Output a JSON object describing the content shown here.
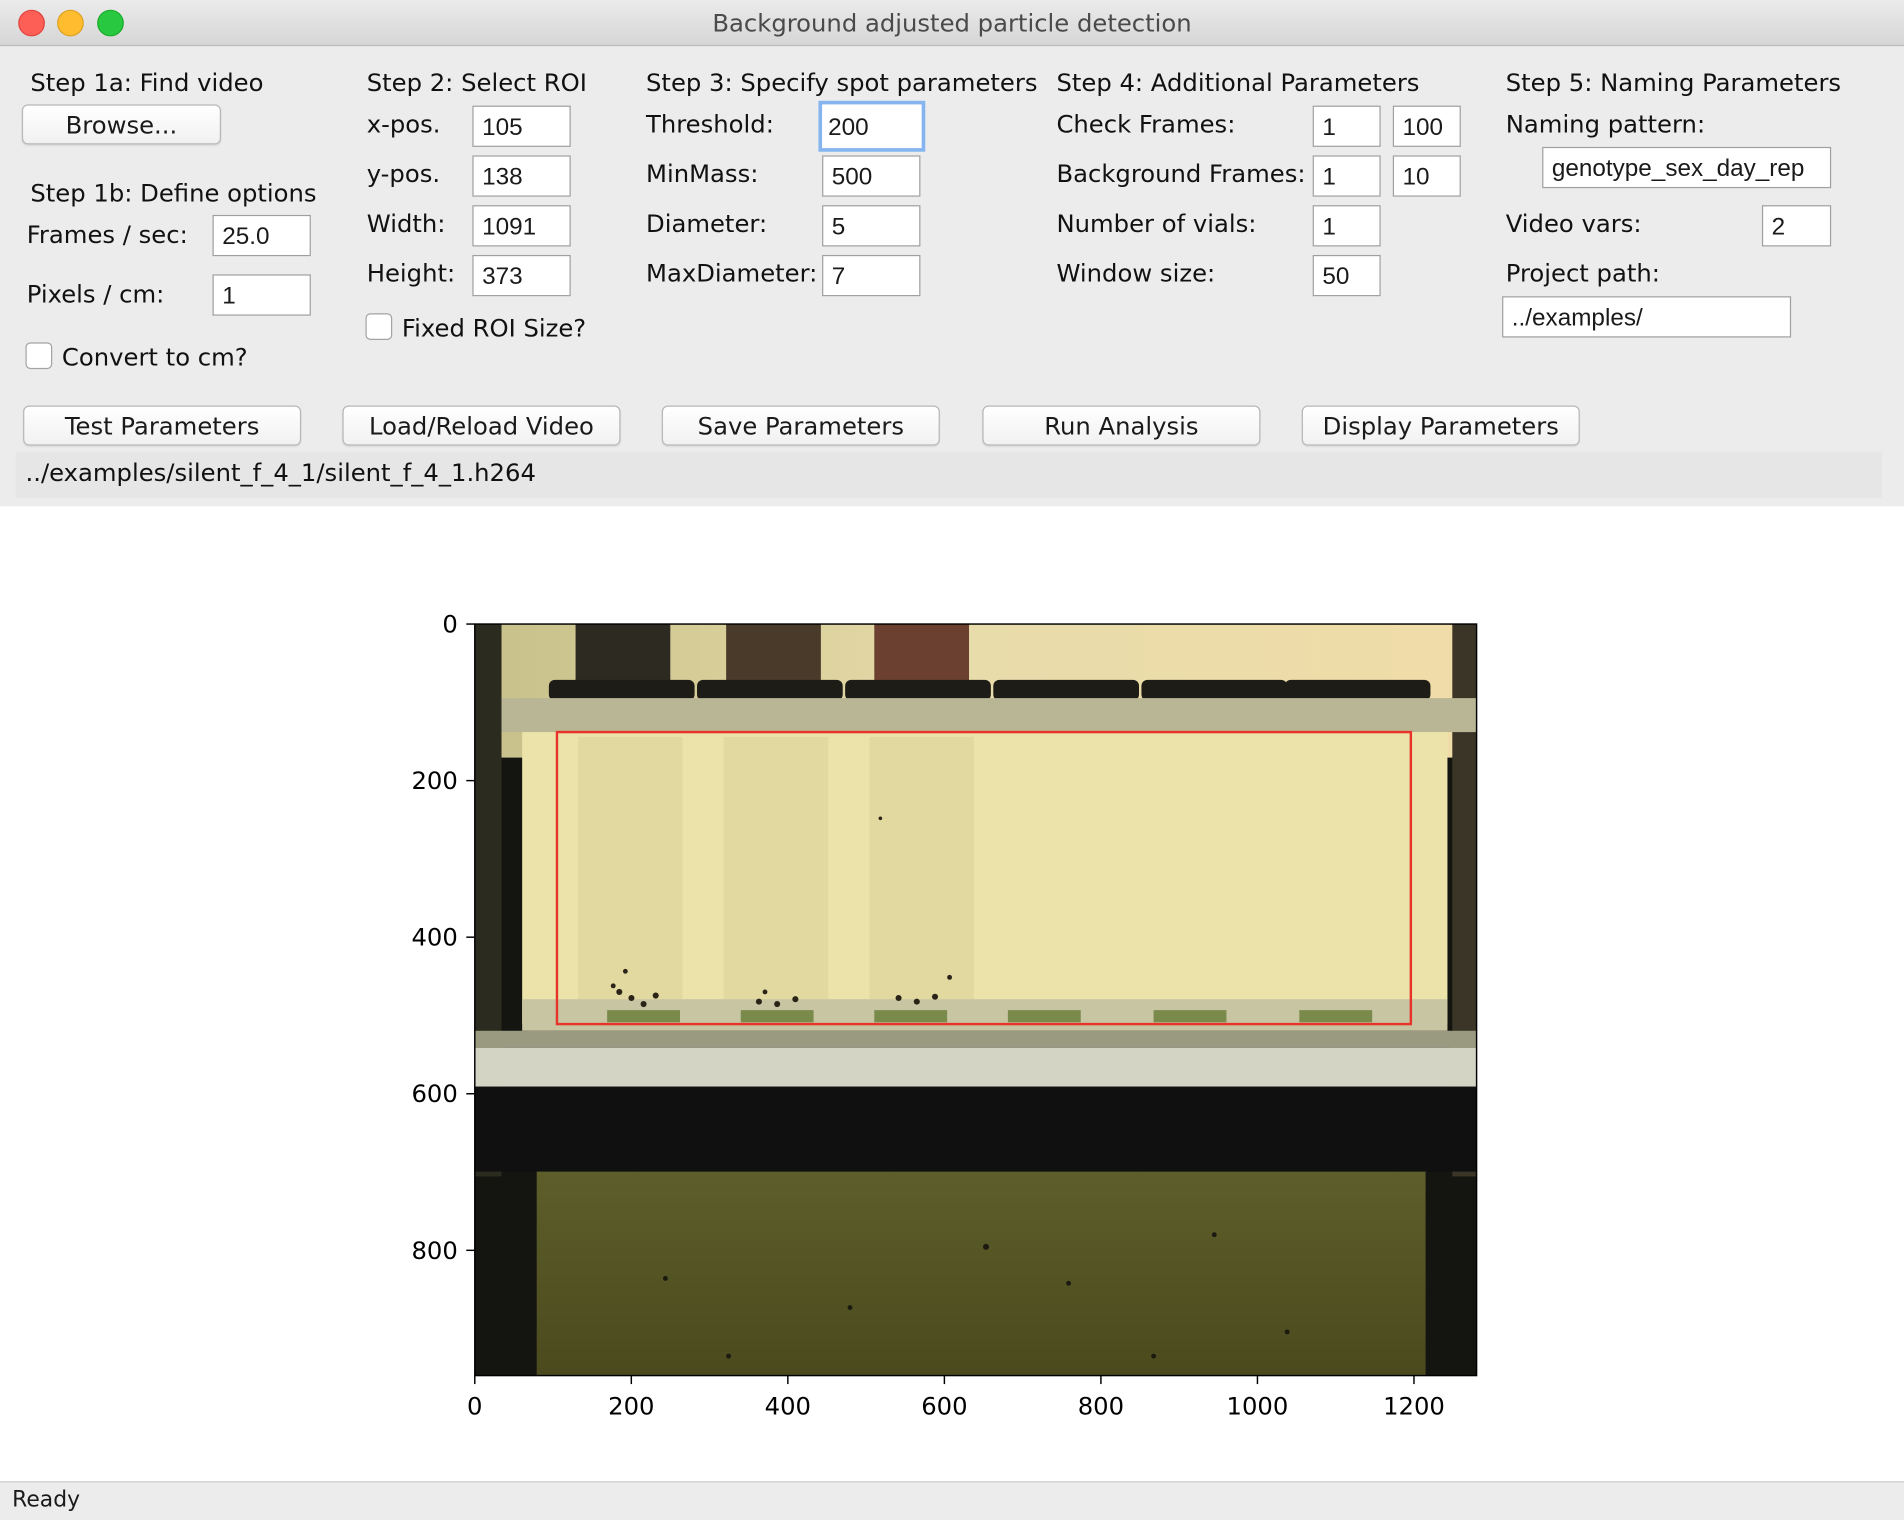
{
  "window": {
    "title": "Background adjusted particle detection"
  },
  "step1": {
    "heading_a": "Step 1a: Find video",
    "browse_label": "Browse...",
    "heading_b": "Step 1b: Define options",
    "fps_label": "Frames / sec:",
    "fps_value": "25.0",
    "pixels_label": "Pixels / cm:",
    "pixels_value": "1",
    "convert_label": "Convert to cm?",
    "convert_checked": false
  },
  "step2": {
    "heading": "Step 2: Select ROI",
    "x_label": "x-pos.",
    "x_value": "105",
    "y_label": "y-pos.",
    "y_value": "138",
    "width_label": "Width:",
    "width_value": "1091",
    "height_label": "Height:",
    "height_value": "373",
    "fixed_label": "Fixed ROI Size?",
    "fixed_checked": false
  },
  "step3": {
    "heading": "Step 3: Specify spot parameters",
    "threshold_label": "Threshold:",
    "threshold_value": "200",
    "minmass_label": "MinMass:",
    "minmass_value": "500",
    "diameter_label": "Diameter:",
    "diameter_value": "5",
    "maxdiameter_label": "MaxDiameter:",
    "maxdiameter_value": "7"
  },
  "step4": {
    "heading": "Step 4: Additional Parameters",
    "check_label": "Check Frames:",
    "check_from": "1",
    "check_to": "100",
    "bg_label": "Background Frames:",
    "bg_from": "1",
    "bg_to": "10",
    "vials_label": "Number of vials:",
    "vials_value": "1",
    "window_label": "Window size:",
    "window_value": "50"
  },
  "step5": {
    "heading": "Step 5: Naming Parameters",
    "pattern_label": "Naming pattern:",
    "pattern_value": "genotype_sex_day_rep",
    "vars_label": "Video vars:",
    "vars_value": "2",
    "path_label": "Project path:",
    "path_value": "../examples/"
  },
  "actions": {
    "test": "Test Parameters",
    "load": "Load/Reload Video",
    "save": "Save Parameters",
    "run": "Run Analysis",
    "display": "Display Parameters"
  },
  "video_path": "../examples/silent_f_4_1/silent_f_4_1.h264",
  "plot": {
    "x_ticks": [
      "0",
      "200",
      "400",
      "600",
      "800",
      "1000",
      "1200"
    ],
    "y_ticks": [
      "0",
      "200",
      "400",
      "600",
      "800"
    ],
    "image_width": 1280,
    "image_height": 960,
    "roi": {
      "x": 105,
      "y": 138,
      "w": 1091,
      "h": 373,
      "color": "#e8332a"
    }
  },
  "status": "Ready"
}
